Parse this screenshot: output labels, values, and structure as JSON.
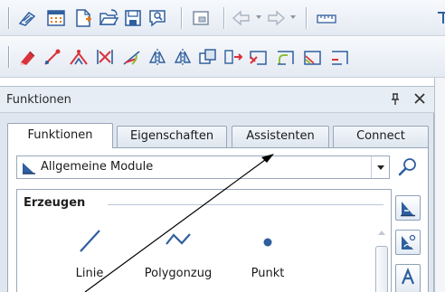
{
  "toolbar_top": {
    "icons": [
      "macro-icon",
      "grid-icon",
      "new-document-icon",
      "open-folder-icon",
      "save-icon",
      "preview-icon",
      "window-icon",
      "undo-icon",
      "redo-icon",
      "measure-icon"
    ]
  },
  "toolbar_edit": {
    "icons": [
      "delete-icon",
      "move-icon",
      "copy-icon",
      "mirror-icon",
      "rotate-icon",
      "mirror-copy-icon",
      "mirror-axis-icon",
      "duplicate-icon",
      "stretch-icon",
      "modify-line-icon",
      "fillet-icon",
      "chamfer-icon",
      "extend-icon"
    ]
  },
  "panel": {
    "title": "Funktionen",
    "pin_glyph": "ᴘ",
    "close_glyph": "✕"
  },
  "tabs": [
    {
      "label": "Funktionen",
      "active": true
    },
    {
      "label": "Eigenschaften",
      "active": false
    },
    {
      "label": "Assistenten",
      "active": false
    },
    {
      "label": "Connect",
      "active": false
    }
  ],
  "module_select": {
    "value": "Allgemeine Module"
  },
  "group": {
    "title": "Erzeugen",
    "tools": [
      {
        "label": "Linie",
        "icon": "line-icon"
      },
      {
        "label": "Polygonzug",
        "icon": "polyline-icon"
      },
      {
        "label": "Punkt",
        "icon": "point-icon"
      }
    ]
  },
  "colors": {
    "accent": "#1f5fa8",
    "icon_blue": "#2f5f9e",
    "panel_bg": "#dfe6ef"
  }
}
